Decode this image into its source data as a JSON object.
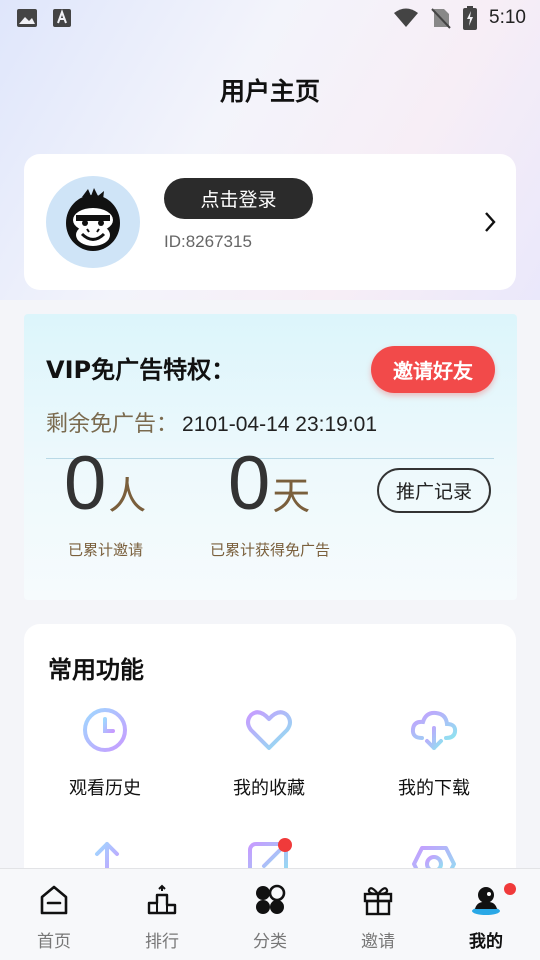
{
  "status_bar": {
    "time": "5:10"
  },
  "page": {
    "title": "用户主页"
  },
  "user": {
    "login_label": "点击登录",
    "id_text": "ID:8267315"
  },
  "vip": {
    "title": "VIP免广告特权：",
    "invite_label": "邀请好友",
    "remain_label": "剩余免广告：",
    "remain_value": "2101-04-14 23:19:01",
    "invited_count": "0",
    "invited_unit": "人",
    "invited_label": "已累计邀请",
    "days_count": "0",
    "days_unit": "天",
    "days_label": "已累计获得免广告",
    "record_label": "推广记录"
  },
  "functions": {
    "title": "常用功能",
    "items": [
      {
        "label": "观看历史",
        "icon": "clock-icon"
      },
      {
        "label": "我的收藏",
        "icon": "heart-icon"
      },
      {
        "label": "我的下载",
        "icon": "cloud-download-icon"
      }
    ]
  },
  "tabs": [
    {
      "label": "首页",
      "icon": "home-icon"
    },
    {
      "label": "排行",
      "icon": "podium-icon"
    },
    {
      "label": "分类",
      "icon": "category-icon"
    },
    {
      "label": "邀请",
      "icon": "gift-icon"
    },
    {
      "label": "我的",
      "icon": "profile-icon",
      "active": true
    }
  ],
  "colors": {
    "accent_red": "#f24a4a",
    "dark_button": "#2b2b2b",
    "gold_text": "#7a5f3c",
    "vip_bg": "#dcf5fb"
  }
}
